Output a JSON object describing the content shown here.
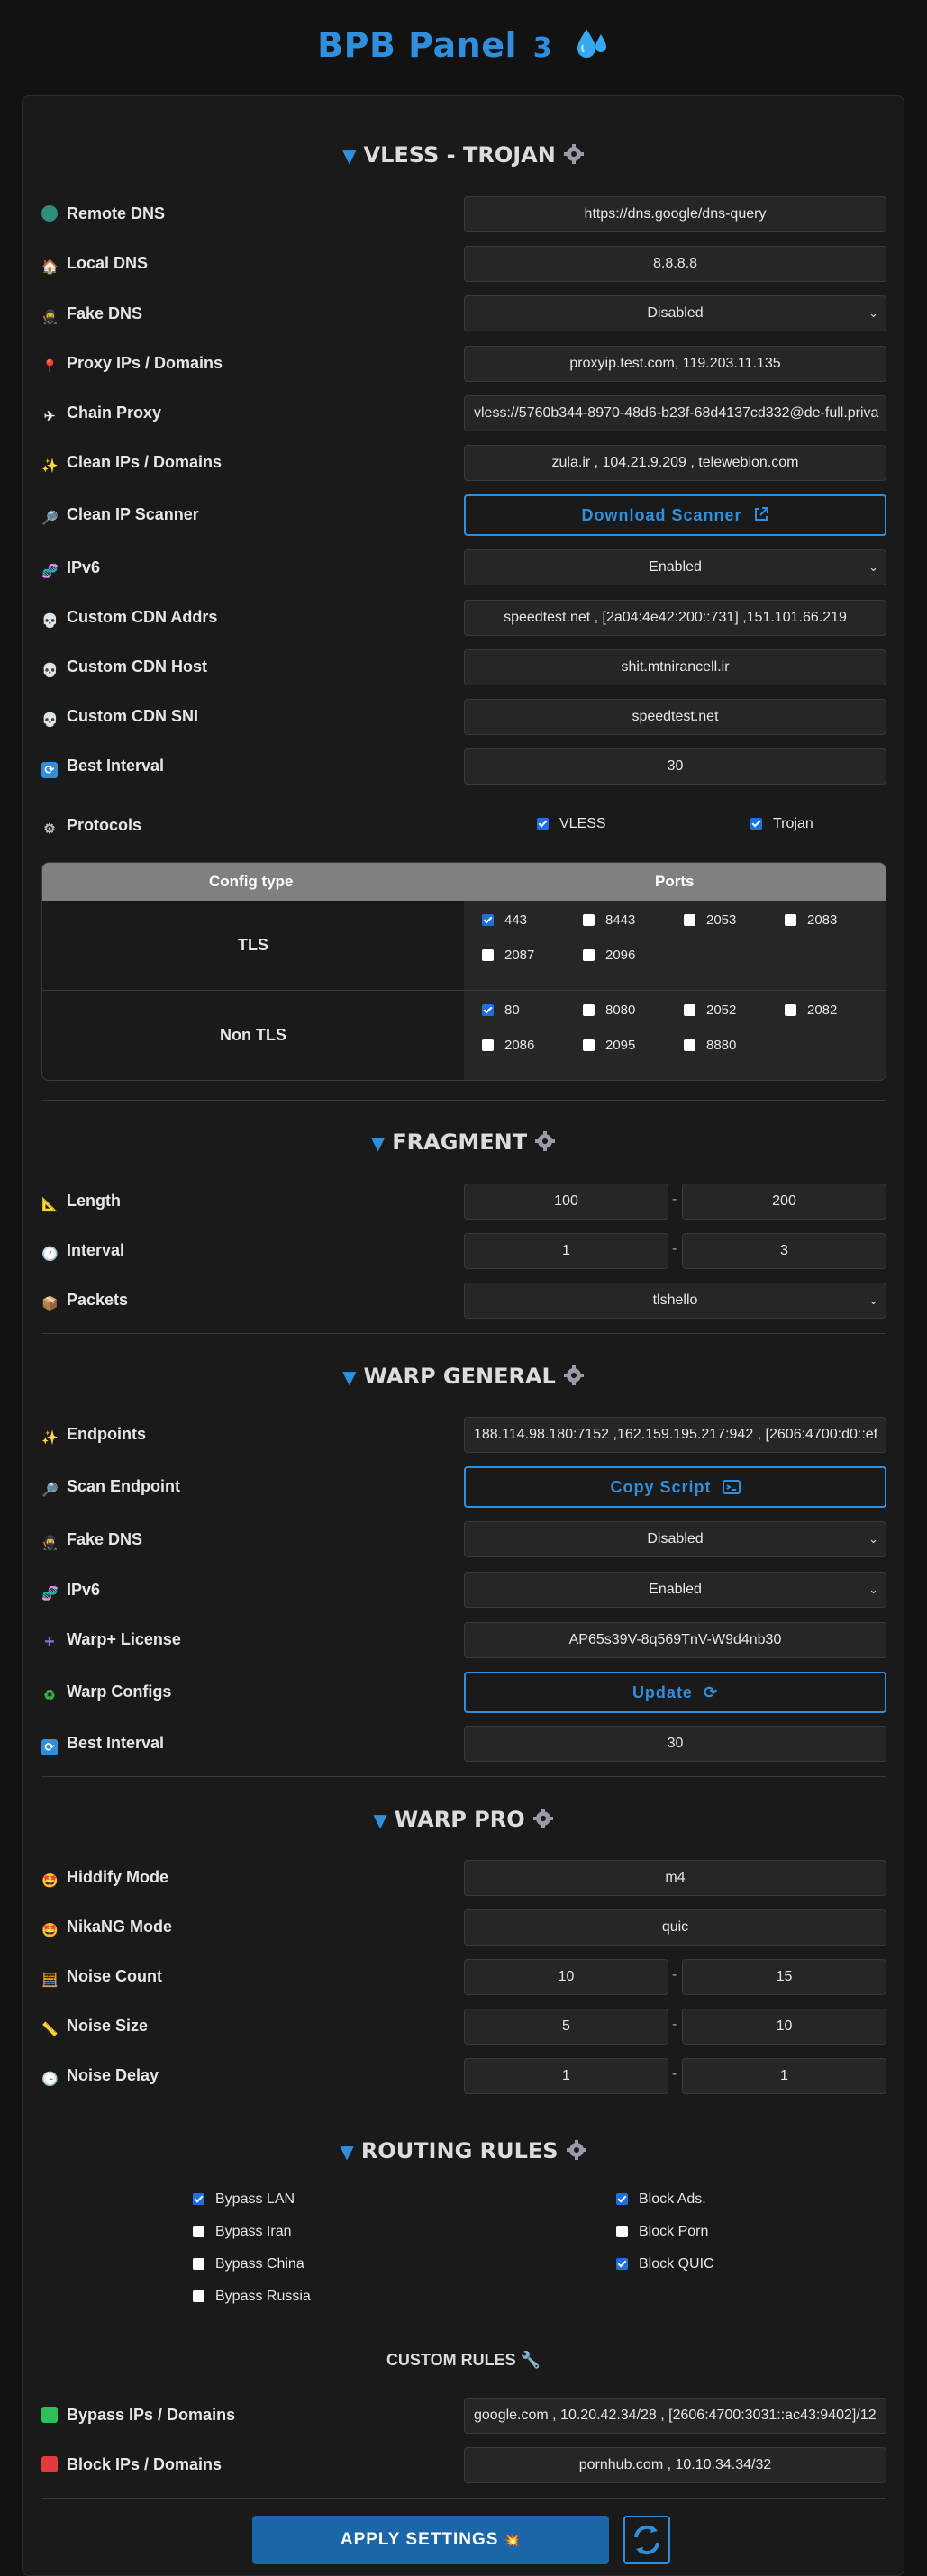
{
  "header": {
    "title": "BPB Panel",
    "version": "3"
  },
  "vless": {
    "title": "VLESS - TROJAN",
    "remote_dns": {
      "label": "Remote DNS",
      "value": "https://dns.google/dns-query"
    },
    "local_dns": {
      "label": "Local DNS",
      "value": "8.8.8.8"
    },
    "fake_dns": {
      "label": "Fake DNS",
      "value": "Disabled"
    },
    "proxy_ips": {
      "label": "Proxy IPs / Domains",
      "value": "proxyip.test.com, 119.203.11.135"
    },
    "chain_proxy": {
      "label": "Chain Proxy",
      "value": "vless://5760b344-8970-48d6-b23f-68d4137cd332@de-full.priva"
    },
    "clean_ips": {
      "label": "Clean IPs / Domains",
      "value": "zula.ir , 104.21.9.209 , telewebion.com"
    },
    "scanner": {
      "label": "Clean IP Scanner",
      "button": "Download Scanner"
    },
    "ipv6": {
      "label": "IPv6",
      "value": "Enabled"
    },
    "cdn_addrs": {
      "label": "Custom CDN Addrs",
      "value": "speedtest.net , [2a04:4e42:200::731] ,151.101.66.219"
    },
    "cdn_host": {
      "label": "Custom CDN Host",
      "value": "shit.mtnirancell.ir"
    },
    "cdn_sni": {
      "label": "Custom CDN SNI",
      "value": "speedtest.net"
    },
    "best_interval": {
      "label": "Best Interval",
      "value": "30"
    },
    "protocols": {
      "label": "Protocols",
      "vless": "VLESS",
      "trojan": "Trojan"
    },
    "table": {
      "col_type": "Config type",
      "col_ports": "Ports",
      "tls": {
        "label": "TLS",
        "ports": [
          "443",
          "8443",
          "2053",
          "2083",
          "2087",
          "2096"
        ],
        "checked": [
          true,
          false,
          false,
          false,
          false,
          false
        ]
      },
      "nontls": {
        "label": "Non TLS",
        "ports": [
          "80",
          "8080",
          "2052",
          "2082",
          "2086",
          "2095",
          "8880"
        ],
        "checked": [
          true,
          false,
          false,
          false,
          false,
          false,
          false
        ]
      }
    }
  },
  "fragment": {
    "title": "FRAGMENT",
    "length": {
      "label": "Length",
      "min": "100",
      "max": "200"
    },
    "interval": {
      "label": "Interval",
      "min": "1",
      "max": "3"
    },
    "packets": {
      "label": "Packets",
      "value": "tlshello"
    }
  },
  "warp": {
    "title": "WARP GENERAL",
    "endpoints": {
      "label": "Endpoints",
      "value": "188.114.98.180:7152 ,162.159.195.217:942 , [2606:4700:d0::ef"
    },
    "scan_endpoint": {
      "label": "Scan Endpoint",
      "button": "Copy Script"
    },
    "fake_dns": {
      "label": "Fake DNS",
      "value": "Disabled"
    },
    "ipv6": {
      "label": "IPv6",
      "value": "Enabled"
    },
    "license": {
      "label": "Warp+ License",
      "value": "AP65s39V-8q569TnV-W9d4nb30"
    },
    "configs": {
      "label": "Warp Configs",
      "button": "Update"
    },
    "best_interval": {
      "label": "Best Interval",
      "value": "30"
    }
  },
  "warp_pro": {
    "title": "WARP PRO",
    "hiddify": {
      "label": "Hiddify Mode",
      "value": "m4"
    },
    "nikang": {
      "label": "NikaNG Mode",
      "value": "quic"
    },
    "noise_count": {
      "label": "Noise Count",
      "min": "10",
      "max": "15"
    },
    "noise_size": {
      "label": "Noise Size",
      "min": "5",
      "max": "10"
    },
    "noise_delay": {
      "label": "Noise Delay",
      "min": "1",
      "max": "1"
    }
  },
  "routing": {
    "title": "ROUTING RULES",
    "bypass_lan": "Bypass LAN",
    "bypass_iran": "Bypass Iran",
    "bypass_china": "Bypass China",
    "bypass_russia": "Bypass Russia",
    "block_ads": "Block Ads.",
    "block_porn": "Block Porn",
    "block_quic": "Block QUIC",
    "custom_title": "CUSTOM RULES",
    "bypass_ips": {
      "label": "Bypass IPs / Domains",
      "value": "google.com , 10.20.42.34/28 , [2606:4700:3031::ac43:9402]/12"
    },
    "block_ips": {
      "label": "Block IPs / Domains",
      "value": "pornhub.com , 10.10.34.34/32"
    }
  },
  "footer": {
    "apply": "APPLY SETTINGS"
  },
  "colors": {
    "accent": "#2f8fdc",
    "background": "#121212",
    "panel": "#1a1a1a",
    "apply": "#1a66a8",
    "table_header": "#808080"
  }
}
